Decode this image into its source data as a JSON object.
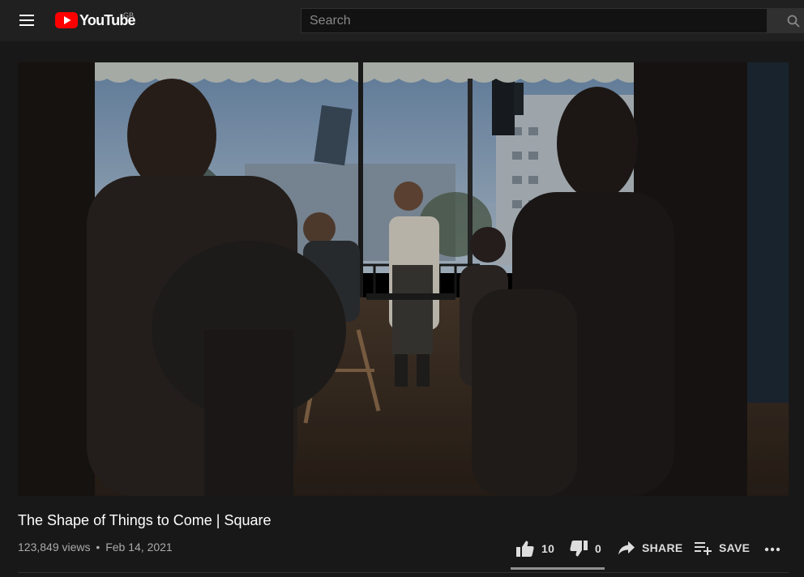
{
  "header": {
    "logo_text": "YouTube",
    "region": "GB",
    "menu_icon": "hamburger-icon",
    "search": {
      "placeholder": "Search",
      "icon": "search-icon"
    }
  },
  "player": {
    "scene": "video-frame"
  },
  "video": {
    "title": "The Shape of Things to Come | Square",
    "views": "123,849 views",
    "separator": "•",
    "date": "Feb 14, 2021"
  },
  "actions": {
    "likes": "10",
    "dislikes": "0",
    "share_label": "SHARE",
    "save_label": "SAVE",
    "like_icon": "thumbs-up-icon",
    "dislike_icon": "thumbs-down-icon",
    "share_icon": "share-arrow-icon",
    "save_icon": "playlist-add-icon",
    "more_icon": "more-horizontal-icon",
    "like_ratio": 1.0
  },
  "colors": {
    "background": "#181818",
    "header": "#202020",
    "brand_red": "#ff0000",
    "text_primary": "#ffffff",
    "text_secondary": "#aaaaaa"
  }
}
